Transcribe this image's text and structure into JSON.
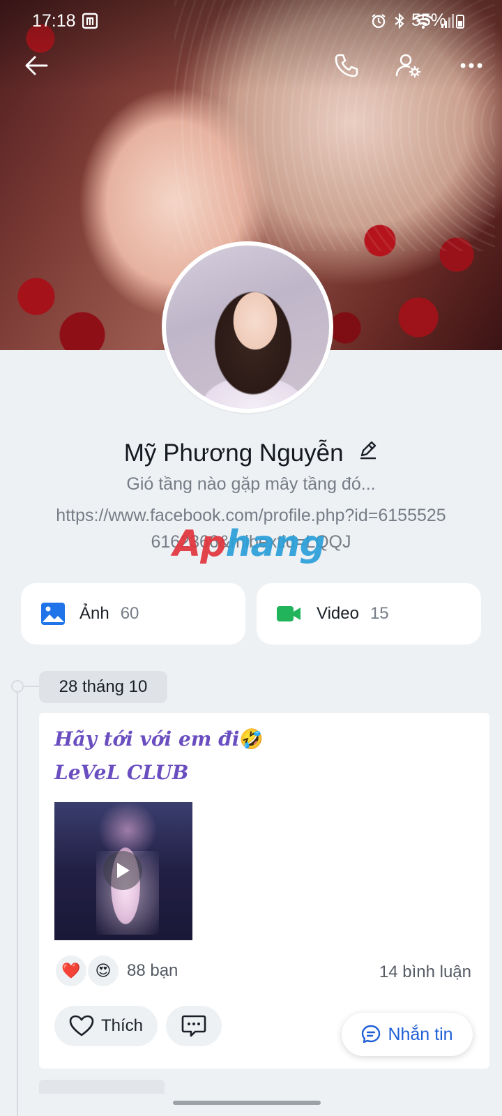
{
  "status_bar": {
    "time": "17:18",
    "battery": "55%",
    "icons": [
      "alarm-icon",
      "bluetooth-icon",
      "wifi-icon",
      "signal-icon",
      "battery-icon"
    ]
  },
  "top_bar": {
    "icons": [
      "back-arrow-icon",
      "phone-icon",
      "user-settings-icon",
      "more-icon"
    ]
  },
  "profile": {
    "name": "Mỹ Phương Nguyễn",
    "bio": "Gió tầng nào gặp mây tầng đó...",
    "link": "https://www.facebook.com/profile.php?id=61555256162366&mibextid=LQQJ"
  },
  "watermark": {
    "part1": "Ap",
    "part2": "hang"
  },
  "media": {
    "photos": {
      "label": "Ảnh",
      "count": "60",
      "icon": "image-icon",
      "color": "#1e74e8"
    },
    "videos": {
      "label": "Video",
      "count": "15",
      "icon": "video-camera-icon",
      "color": "#21b45b"
    }
  },
  "timeline": {
    "date": "28 tháng 10"
  },
  "post": {
    "line1": "Hãy tới với em đi",
    "emoji": "🤣",
    "line2": "LeVeL CLUB",
    "reaction_emojis": [
      "❤️",
      "😍"
    ],
    "reaction_count": "88 bạn",
    "comment_count": "14 bình luận",
    "like_label": "Thích",
    "more": "• • •"
  },
  "fab": {
    "label": "Nhắn tin"
  },
  "colors": {
    "accent": "#1f5fd6",
    "post_text": "#6a4ec0",
    "background": "#eef1f4"
  }
}
